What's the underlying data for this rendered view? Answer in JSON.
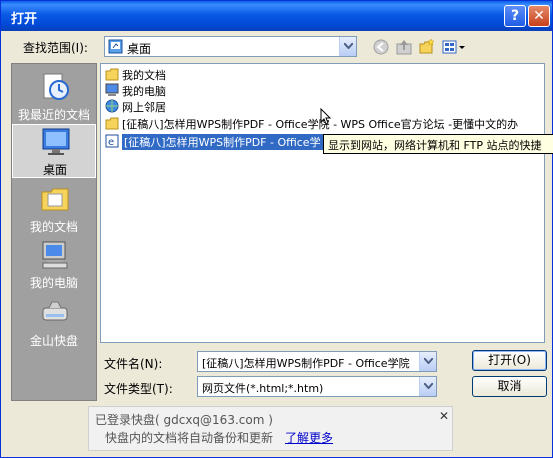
{
  "window": {
    "title": "打开",
    "help_glyph": "?",
    "close_glyph": "✕"
  },
  "lookin": {
    "label": "查找范围(I):",
    "value": "桌面"
  },
  "toolbar": {
    "icons": [
      "back-icon",
      "up-folder-icon",
      "new-folder-icon",
      "views-menu-icon"
    ]
  },
  "places": [
    {
      "label": "我最近的文档",
      "icon": "recent-docs-icon"
    },
    {
      "label": "桌面",
      "icon": "desktop-icon",
      "selected": true
    },
    {
      "label": "我的文档",
      "icon": "my-documents-icon"
    },
    {
      "label": "我的电脑",
      "icon": "my-computer-icon"
    },
    {
      "label": "金山快盘",
      "icon": "kuaipan-drive-icon"
    }
  ],
  "files": [
    {
      "name": "我的文档",
      "icon": "my-documents-icon"
    },
    {
      "name": "我的电脑",
      "icon": "my-computer-icon"
    },
    {
      "name": "网上邻居",
      "icon": "network-places-icon"
    },
    {
      "name": "[征稿八]怎样用WPS制作PDF - Office学院 - WPS Office官方论坛 -更懂中文的办",
      "icon": "folder-icon"
    },
    {
      "name": "[征稿八]怎样用WPS制作PDF - Office学",
      "icon": "ie-page-icon",
      "selected": true
    }
  ],
  "tooltip": "显示到网站，网络计算机和 FTP 站点的快捷",
  "filename": {
    "label": "文件名(N):",
    "value": "[征稿八]怎样用WPS制作PDF - Office学院"
  },
  "filetype": {
    "label": "文件类型(T):",
    "value": "网页文件(*.html;*.htm)"
  },
  "buttons": {
    "open": "打开(O)",
    "cancel": "取消"
  },
  "banner": {
    "line1": "已登录快盘( gdcxq@163.com )",
    "line2": "快盘内的文档将自动备份和更新",
    "link": "了解更多",
    "close": "✕"
  }
}
